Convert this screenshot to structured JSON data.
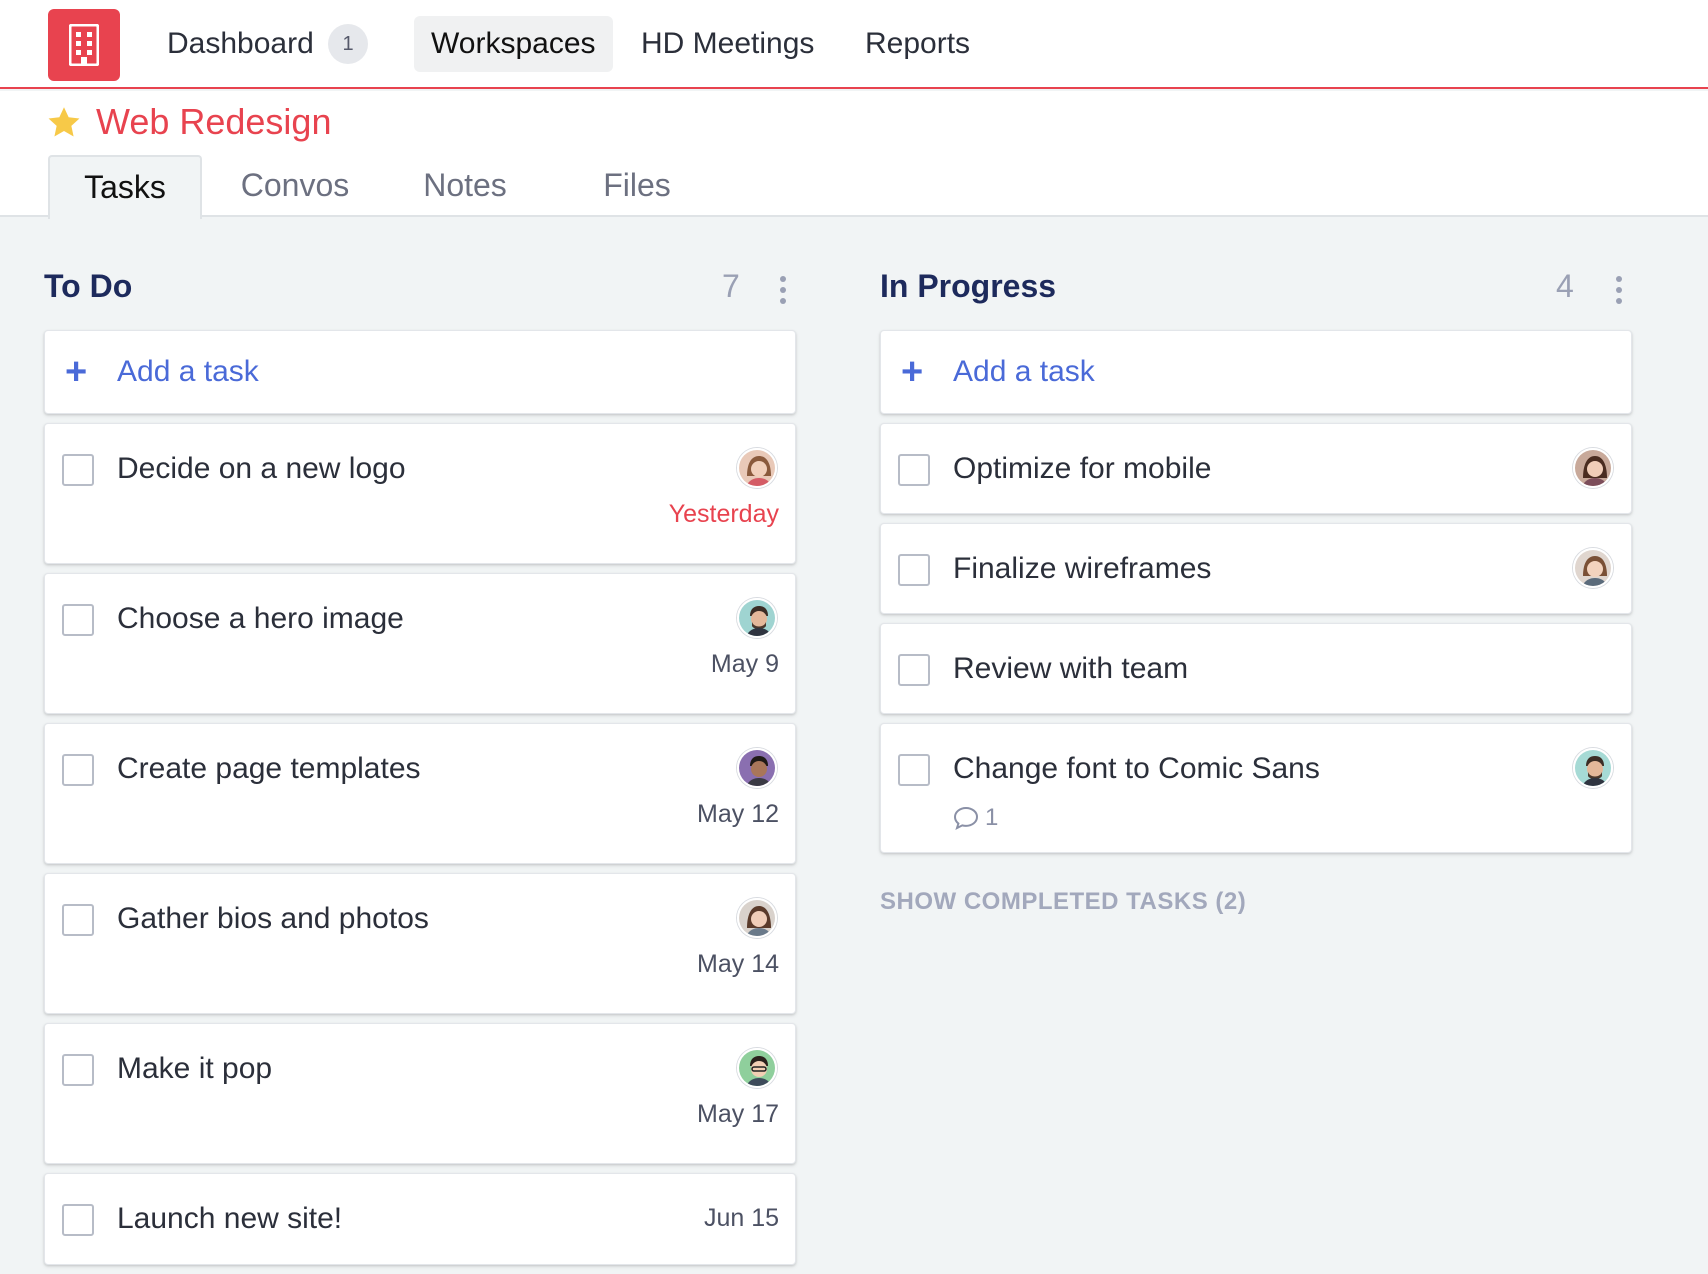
{
  "nav": {
    "items": [
      {
        "label": "Dashboard"
      },
      {
        "label": "Workspaces"
      },
      {
        "label": "HD Meetings"
      },
      {
        "label": "Reports"
      }
    ],
    "dashboard_badge": "1"
  },
  "workspace": {
    "title": "Web Redesign",
    "tabs": [
      {
        "label": "Tasks"
      },
      {
        "label": "Convos"
      },
      {
        "label": "Notes"
      },
      {
        "label": "Files"
      }
    ]
  },
  "columns": [
    {
      "title": "To Do",
      "count": "7",
      "add_label": "Add a task",
      "tasks": [
        {
          "title": "Decide on a new logo",
          "due": "Yesterday",
          "overdue": true,
          "avatar_icon": "avatar-woman-icon"
        },
        {
          "title": "Choose a hero image",
          "due": "May 9",
          "avatar_icon": "avatar-man-icon"
        },
        {
          "title": "Create page templates",
          "due": "May 12",
          "avatar_icon": "avatar-man-icon"
        },
        {
          "title": "Gather bios and photos",
          "due": "May 14",
          "avatar_icon": "avatar-woman-icon"
        },
        {
          "title": "Make it pop",
          "due": "May 17",
          "avatar_icon": "avatar-man-icon"
        },
        {
          "title": "Launch new site!",
          "due": "Jun 15"
        }
      ]
    },
    {
      "title": "In Progress",
      "count": "4",
      "add_label": "Add a task",
      "tasks": [
        {
          "title": "Optimize for mobile",
          "avatar_icon": "avatar-woman-icon"
        },
        {
          "title": "Finalize wireframes",
          "avatar_icon": "avatar-woman-icon"
        },
        {
          "title": "Review with team"
        },
        {
          "title": "Change font to Comic Sans",
          "comments": "1",
          "avatar_icon": "avatar-man-icon"
        }
      ],
      "show_completed": "SHOW COMPLETED TASKS (2)"
    }
  ],
  "colors": {
    "brand": "#e8434f",
    "link": "#4a6ad8",
    "heading": "#1d2a5c"
  }
}
